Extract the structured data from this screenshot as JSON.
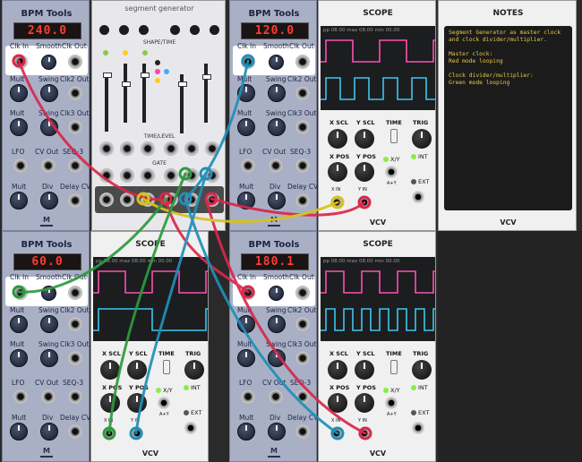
{
  "bpm_modules": [
    {
      "title": "BPM Tools",
      "display": "240.0",
      "clk_in": "Clk In",
      "smooth": "Smooth",
      "clk_out": "Clk Out",
      "mult": "Mult",
      "swing": "Swing",
      "clk2": "Clk2 Out",
      "clk3": "Clk3 Out",
      "lfo": "LFO",
      "cv_out": "CV Out",
      "seq3": "SEQ-3",
      "div": "Div",
      "delay_cv": "Delay CV"
    },
    {
      "title": "BPM Tools",
      "display": "120.0",
      "clk_in": "Clk In",
      "smooth": "Smooth",
      "clk_out": "Clk Out",
      "mult": "Mult",
      "swing": "Swing",
      "clk2": "Clk2 Out",
      "clk3": "Clk3 Out",
      "lfo": "LFO",
      "cv_out": "CV Out",
      "seq3": "SEQ-3",
      "div": "Div",
      "delay_cv": "Delay CV"
    },
    {
      "title": "BPM Tools",
      "display": "60.0",
      "clk_in": "Clk In",
      "smooth": "Smooth",
      "clk_out": "Clk Out",
      "mult": "Mult",
      "swing": "Swing",
      "clk2": "Clk2 Out",
      "clk3": "Clk3 Out",
      "lfo": "LFO",
      "cv_out": "CV Out",
      "seq3": "SEQ-3",
      "div": "Div",
      "delay_cv": "Delay CV"
    },
    {
      "title": "BPM Tools",
      "display": "180.1",
      "clk_in": "Clk In",
      "smooth": "Smooth",
      "clk_out": "Clk Out",
      "mult": "Mult",
      "swing": "Swing",
      "clk2": "Clk2 Out",
      "clk3": "Clk3 Out",
      "lfo": "LFO",
      "cv_out": "CV Out",
      "seq3": "SEQ-3",
      "div": "Div",
      "delay_cv": "Delay CV"
    }
  ],
  "segment_generator": {
    "title": "segment generator",
    "shape_time": "SHAPE/TIME",
    "time_level": "TIME/LEVEL",
    "gate": "GATE"
  },
  "scope_modules": [
    {
      "title": "SCOPE",
      "readout": "pp 08.00 max 08.00 min 00.00",
      "x_scl": "X SCL",
      "y_scl": "Y SCL",
      "time": "TIME",
      "trig": "TRIG",
      "x_pos": "X POS",
      "y_pos": "Y POS",
      "xy": "X/Y",
      "int": "INT",
      "axy": "A+Y",
      "ext": "EXT",
      "x_in": "X IN",
      "y_in": "Y IN",
      "brand": "VCV"
    },
    {
      "title": "SCOPE",
      "readout": "pp 08.00 max 08.00 min 00.00",
      "x_scl": "X SCL",
      "y_scl": "Y SCL",
      "time": "TIME",
      "trig": "TRIG",
      "x_pos": "X POS",
      "y_pos": "Y POS",
      "xy": "X/Y",
      "int": "INT",
      "axy": "A+Y",
      "ext": "EXT",
      "x_in": "X IN",
      "y_in": "Y IN",
      "brand": "VCV"
    },
    {
      "title": "SCOPE",
      "readout": "pp 08.00 max 08.00 min 00.00",
      "x_scl": "X SCL",
      "y_scl": "Y SCL",
      "time": "TIME",
      "trig": "TRIG",
      "x_pos": "X POS",
      "y_pos": "Y POS",
      "xy": "X/Y",
      "int": "INT",
      "axy": "A+Y",
      "ext": "EXT",
      "x_in": "X IN",
      "y_in": "Y IN",
      "brand": "VCV"
    }
  ],
  "notes": {
    "title": "NOTES",
    "text": "Segment Generator as master clock\nand clock divider/multiplier.\n\nMaster clock:\nRed mode looping\n\nClock divider/multiplier:\nGreen mode looping",
    "brand": "VCV"
  },
  "colors": {
    "panel_bpm": "#a9b0c6",
    "lcd_text": "#ff3b30",
    "trace_pink": "#ff4fb2",
    "trace_cyan": "#3fc6f0",
    "cable_red": "#d8284a",
    "cable_green": "#2e9a3e",
    "cable_blue": "#1f8fb8",
    "cable_yellow": "#d9c21a",
    "notes_text": "#e8c84a"
  }
}
